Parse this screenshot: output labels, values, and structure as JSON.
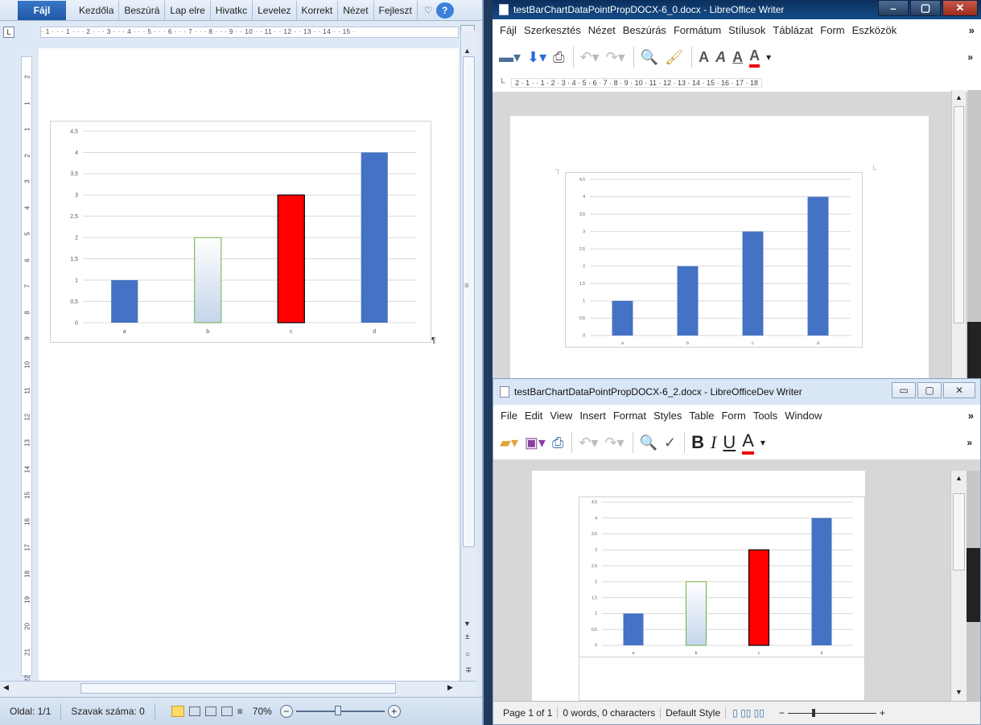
{
  "word": {
    "file_tab": "Fájl",
    "tabs": [
      "Kezdőla",
      "Beszúrá",
      "Lap elre",
      "Hivatkc",
      "Levelez",
      "Korrekt",
      "Nézet",
      "Fejleszt"
    ],
    "ruler_corner": "L",
    "ruler_text": "· 1 · · · 1 · · · 2 · · · 3 · · · 4 · · · 5 · · · 6 · · · 7 · · · 8 · · · 9 · · 10 · · 11 · · 12 · · 13 · · 14 · · 15 ·",
    "status": {
      "page": "Oldal: 1/1",
      "words": "Szavak száma: 0",
      "zoom": "70%"
    },
    "paragraph_mark": "¶"
  },
  "lo1": {
    "title": "testBarChartDataPointPropDOCX-6_0.docx - LibreOffice Writer",
    "menu": [
      "Fájl",
      "Szerkesztés",
      "Nézet",
      "Beszúrás",
      "Formátum",
      "Stílusok",
      "Táblázat",
      "Form",
      "Eszközök"
    ],
    "ruler_text": "2 · 1 ·    · 1 · 2 · 3 · 4 · 5 · 6 · 7 · 8 · 9 · 10 · 11 · 12 · 13 · 14 · 15 · 16 · 17 · 18"
  },
  "lo2": {
    "title": "testBarChartDataPointPropDOCX-6_2.docx - LibreOfficeDev Writer",
    "menu": [
      "File",
      "Edit",
      "View",
      "Insert",
      "Format",
      "Styles",
      "Table",
      "Form",
      "Tools",
      "Window"
    ],
    "status": {
      "page": "Page 1 of 1",
      "words": "0 words, 0 characters",
      "style": "Default Style"
    }
  },
  "chart_data": [
    {
      "type": "bar",
      "categories": [
        "a",
        "b",
        "c",
        "d"
      ],
      "values": [
        1,
        2,
        3,
        4
      ],
      "ylim": [
        0,
        4.5
      ],
      "y_ticks": [
        "0",
        "0,5",
        "1",
        "1,5",
        "2",
        "2,5",
        "3",
        "3,5",
        "4",
        "4,5"
      ],
      "point_styles": [
        "#4472c4",
        "gradient-green-outline",
        "#ff0000",
        "#4472c4"
      ],
      "grid": true
    },
    {
      "type": "bar",
      "categories": [
        "a",
        "b",
        "c",
        "d"
      ],
      "values": [
        1,
        2,
        3,
        4
      ],
      "ylim": [
        0,
        4.5
      ],
      "y_ticks": [
        "0",
        "0,5",
        "1",
        "1,5",
        "2",
        "2,5",
        "3",
        "3,5",
        "4",
        "4,5"
      ],
      "point_styles": [
        "#4472c4",
        "#4472c4",
        "#4472c4",
        "#4472c4"
      ],
      "grid": true
    },
    {
      "type": "bar",
      "categories": [
        "a",
        "b",
        "c",
        "d"
      ],
      "values": [
        1,
        2,
        3,
        4
      ],
      "ylim": [
        0,
        4.5
      ],
      "y_ticks": [
        "0",
        "0,5",
        "1",
        "1,5",
        "2",
        "2,5",
        "3",
        "3,5",
        "4",
        "4,5"
      ],
      "point_styles": [
        "#4472c4",
        "gradient-green-outline",
        "#ff0000",
        "#4472c4"
      ],
      "grid": true
    }
  ]
}
